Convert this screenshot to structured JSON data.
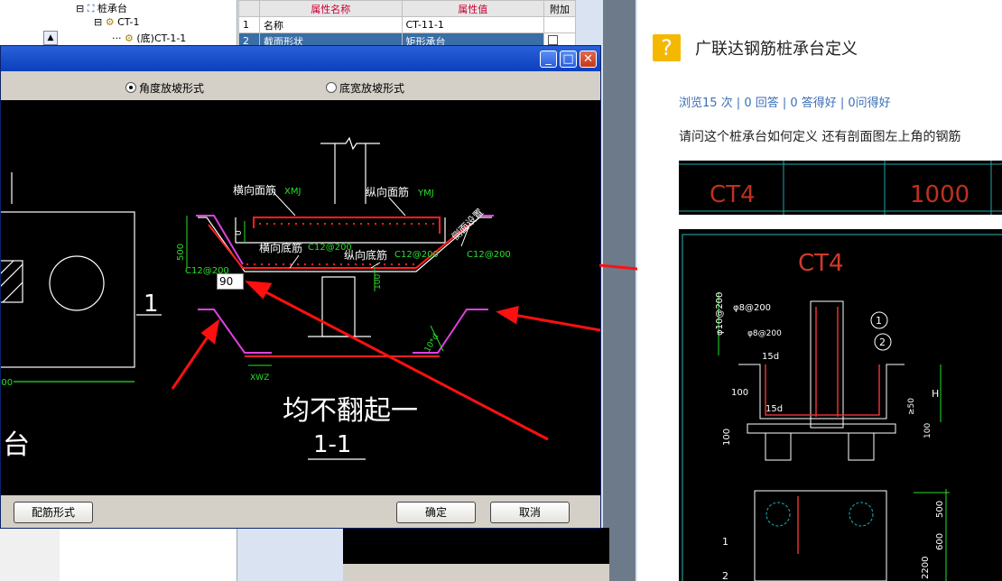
{
  "tree": {
    "root_label": "桩承台",
    "child_label": "CT-1",
    "leaf_label": "(底)CT-1-1"
  },
  "properties": {
    "headers": [
      "属性名称",
      "属性值",
      "附加"
    ],
    "rows": [
      {
        "num": "1",
        "name": "名称",
        "value": "CT-11-1"
      },
      {
        "num": "2",
        "name": "截面形状",
        "value": "矩形承台"
      }
    ]
  },
  "dialog": {
    "radio_angle": "角度放坡形式",
    "radio_width": "底宽放坡形式",
    "rebar_form_button": "配筋形式",
    "ok_button": "确定",
    "cancel_button": "取消",
    "close_glyph": "✕",
    "max_glyph": "□",
    "min_glyph": "_"
  },
  "drawing": {
    "label_h_top": "横向面筋",
    "label_h_top_code": "XMJ",
    "label_v_top": "纵向面筋",
    "label_v_top_code": "YMJ",
    "label_h_bottom": "横向底筋",
    "label_h_bottom_code": "C12@200",
    "label_v_bottom": "纵向底筋",
    "label_v_bottom_code": "C12@200",
    "label_side_right": "C12@200",
    "label_side_left": "C12@200",
    "label_side_setting": "侧面设置",
    "dim_500": "500",
    "dim_0": "0",
    "dim_100": "100",
    "dim_10d": "10*d",
    "dim_xwz": "XWZ",
    "input_value": "90",
    "section_mark": "1",
    "plan_dim": "500",
    "big_note": "均不翻起一",
    "section_title": "1-1",
    "left_partial_text": "台"
  },
  "qa": {
    "badge": "?",
    "title": "广联达钢筋桩承台定义",
    "stats": "浏览15 次 | 0 回答 | 0 答得好 | 0问得好",
    "body": "请问这个桩承台如何定义  还有剖面图左上角的钢筋"
  },
  "attachment1": {
    "cells": [
      "CT4",
      "1000"
    ]
  },
  "attachment2": {
    "title": "CT4",
    "labels": [
      "φ10@200",
      "φ8@200",
      "φ8@200",
      "1",
      "2",
      "15d",
      "15d",
      "100",
      "100",
      "≥50",
      "H",
      "100",
      "500",
      "600",
      "2200",
      "1",
      "2"
    ]
  },
  "colors": {
    "title_bar": "#0b3fbd",
    "rebar_red": "#ff2020",
    "slope_magenta": "#e040e0",
    "dim_green": "#28e028",
    "link_blue": "#3b6fb6",
    "badge_orange": "#f5b800"
  }
}
